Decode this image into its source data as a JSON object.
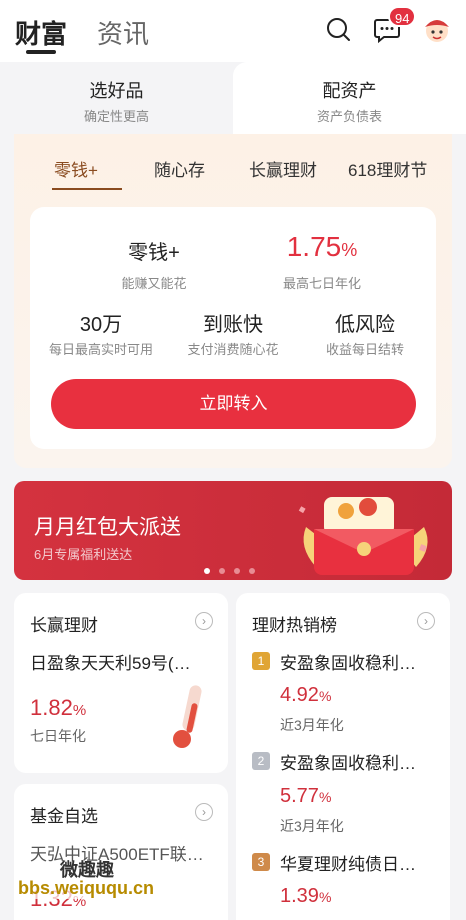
{
  "header": {
    "tabs": [
      {
        "label": "财富",
        "active": true
      },
      {
        "label": "资讯",
        "active": false
      }
    ],
    "message_badge": "94",
    "icons": [
      "search-icon",
      "message-icon",
      "avatar"
    ]
  },
  "segments": [
    {
      "title": "选好品",
      "subtitle": "确定性更高"
    },
    {
      "title": "配资产",
      "subtitle": "资产负债表"
    }
  ],
  "product_tabs": [
    "零钱+",
    "随心存",
    "长赢理财",
    "618理财节"
  ],
  "product_card": {
    "name": "零钱+",
    "name_sub": "能赚又能花",
    "rate": "1.75",
    "rate_unit": "%",
    "rate_sub": "最高七日年化",
    "features": [
      {
        "title": "30万",
        "sub": "每日最高实时可用"
      },
      {
        "title": "到账快",
        "sub": "支付消费随心花"
      },
      {
        "title": "低风险",
        "sub": "收益每日结转"
      }
    ],
    "cta": "立即转入"
  },
  "banner": {
    "title": "月月红包大派送",
    "subtitle": "6月专属福利送达",
    "dots": 4,
    "active_dot": 0
  },
  "changying": {
    "title": "长赢理财",
    "product": "日盈象天天利59号(…",
    "rate": "1.82",
    "rate_unit": "%",
    "rate_sub": "七日年化"
  },
  "fund_pick": {
    "title": "基金自选",
    "product": "天弘中证A500ETF联…",
    "rate": "1.32",
    "rate_unit": "%"
  },
  "hot_list": {
    "title": "理财热销榜",
    "items": [
      {
        "rank": "1",
        "name": "安盈象固收稳利…",
        "rate": "4.92",
        "unit": "%",
        "sub": "近3月年化"
      },
      {
        "rank": "2",
        "name": "安盈象固收稳利…",
        "rate": "5.77",
        "unit": "%",
        "sub": "近3月年化"
      },
      {
        "rank": "3",
        "name": "华夏理财纯债日…",
        "rate": "1.39",
        "unit": "%",
        "sub": ""
      }
    ]
  },
  "watermark": {
    "line1": "微趣趣",
    "line2": "bbs.weiququ.cn"
  },
  "colors": {
    "accent_red": "#e8303f",
    "brand_gold": "#8a4b1f",
    "rank_gold": "#e0a535",
    "rank_silver": "#b8bcc4",
    "rank_bronze": "#cf8a4a"
  }
}
